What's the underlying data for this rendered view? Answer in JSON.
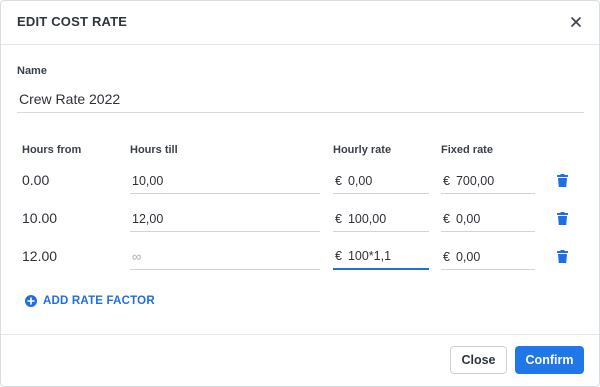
{
  "dialog": {
    "title": "EDIT COST RATE",
    "close_icon": "close-icon"
  },
  "name": {
    "label": "Name",
    "value": "Crew Rate 2022"
  },
  "table": {
    "headers": {
      "hours_from": "Hours from",
      "hours_till": "Hours till",
      "hourly_rate": "Hourly rate",
      "fixed_rate": "Fixed rate"
    },
    "currency_symbol": "€",
    "rows": [
      {
        "hours_from": "0.00",
        "hours_till": "10,00",
        "hourly_rate": "0,00",
        "fixed_rate": "700,00"
      },
      {
        "hours_from": "10.00",
        "hours_till": "12,00",
        "hourly_rate": "100,00",
        "fixed_rate": "0,00"
      },
      {
        "hours_from": "12.00",
        "hours_till_placeholder": "∞",
        "hourly_rate": "100*1,1",
        "fixed_rate": "0,00"
      }
    ],
    "row_action_icon": "trash-icon"
  },
  "add_rate_factor": {
    "label": "ADD RATE FACTOR",
    "icon": "plus-circle-icon"
  },
  "footer": {
    "close_label": "Close",
    "confirm_label": "Confirm"
  },
  "colors": {
    "accent": "#2176e8",
    "link": "#1f6fe0",
    "text": "#2d3138"
  }
}
